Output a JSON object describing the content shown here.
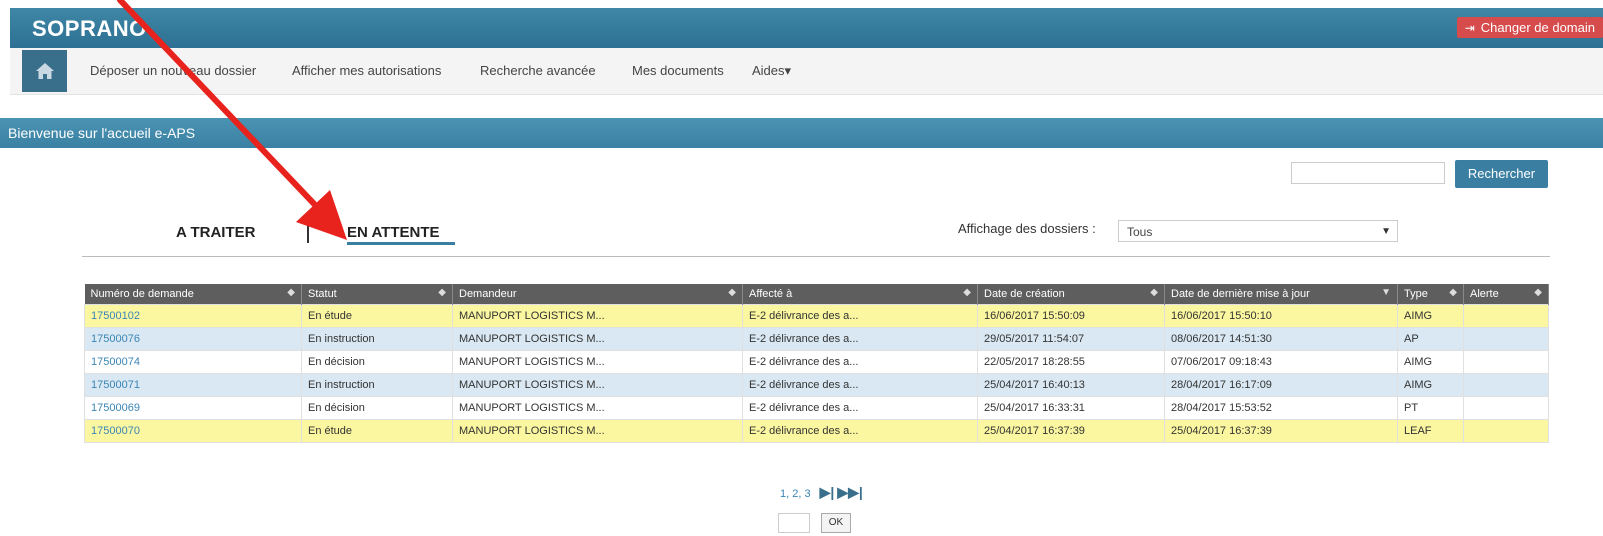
{
  "header": {
    "brand": "SOPRANO",
    "domain_button": "Changer de domain",
    "domain_icon": "sign-out-icon"
  },
  "nav": {
    "home_icon": "home-icon",
    "items": [
      "Déposer un nouveau dossier",
      "Afficher mes autorisations",
      "Recherche avancée",
      "Mes documents",
      "Aides▾"
    ]
  },
  "welcome": "Bienvenue sur l'accueil e-APS",
  "search": {
    "button": "Rechercher",
    "value": ""
  },
  "tabs": {
    "a_traiter": "A TRAITER",
    "en_attente": "EN ATTENTE",
    "active": "en_attente"
  },
  "filter": {
    "label": "Affichage des dossiers :",
    "selected": "Tous"
  },
  "table": {
    "columns": [
      "Numéro de demande",
      "Statut",
      "Demandeur",
      "Affecté à",
      "Date de création",
      "Date de dernière mise à jour",
      "Type",
      "Alerte"
    ],
    "rows": [
      {
        "num": "17500102",
        "statut": "En étude",
        "demandeur": "MANUPORT LOGISTICS M...",
        "affecte": "E-2 délivrance des a...",
        "creation": "16/06/2017 15:50:09",
        "maj": "16/06/2017 15:50:10",
        "type": "AIMG",
        "alerte": "",
        "style": "yellow"
      },
      {
        "num": "17500076",
        "statut": "En instruction",
        "demandeur": "MANUPORT LOGISTICS M...",
        "affecte": "E-2 délivrance des a...",
        "creation": "29/05/2017 11:54:07",
        "maj": "08/06/2017 14:51:30",
        "type": "AP",
        "alerte": "",
        "style": "blue"
      },
      {
        "num": "17500074",
        "statut": "En décision",
        "demandeur": "MANUPORT LOGISTICS M...",
        "affecte": "E-2 délivrance des a...",
        "creation": "22/05/2017 18:28:55",
        "maj": "07/06/2017 09:18:43",
        "type": "AIMG",
        "alerte": "",
        "style": "white"
      },
      {
        "num": "17500071",
        "statut": "En instruction",
        "demandeur": "MANUPORT LOGISTICS M...",
        "affecte": "E-2 délivrance des a...",
        "creation": "25/04/2017 16:40:13",
        "maj": "28/04/2017 16:17:09",
        "type": "AIMG",
        "alerte": "",
        "style": "blue"
      },
      {
        "num": "17500069",
        "statut": "En décision",
        "demandeur": "MANUPORT LOGISTICS M...",
        "affecte": "E-2 délivrance des a...",
        "creation": "25/04/2017 16:33:31",
        "maj": "28/04/2017 15:53:52",
        "type": "PT",
        "alerte": "",
        "style": "white"
      },
      {
        "num": "17500070",
        "statut": "En étude",
        "demandeur": "MANUPORT LOGISTICS M...",
        "affecte": "E-2 délivrance des a...",
        "creation": "25/04/2017 16:37:39",
        "maj": "25/04/2017 16:37:39",
        "type": "LEAF",
        "alerte": "",
        "style": "yellow"
      }
    ]
  },
  "pager": {
    "pages": "1, 2, 3",
    "next_icon": "skip-next-icon",
    "last_icon": "skip-last-icon",
    "ok": "OK"
  },
  "colors": {
    "header": "#2d7093",
    "danger": "#d64b4b",
    "highlight": "#fbf7a0",
    "alt_row": "#d9e8f2",
    "annotation": "#e8231e"
  }
}
